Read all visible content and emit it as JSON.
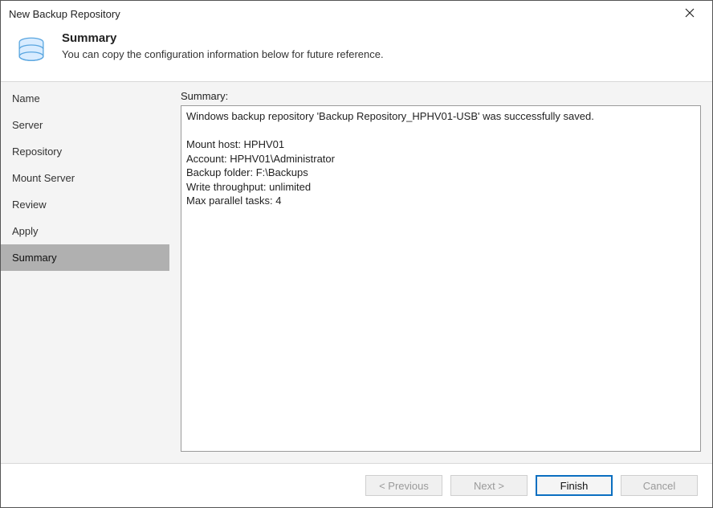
{
  "window": {
    "title": "New Backup Repository"
  },
  "header": {
    "heading": "Summary",
    "subheading": "You can copy the configuration information below for future reference."
  },
  "sidebar": {
    "items": [
      {
        "label": "Name",
        "active": false
      },
      {
        "label": "Server",
        "active": false
      },
      {
        "label": "Repository",
        "active": false
      },
      {
        "label": "Mount Server",
        "active": false
      },
      {
        "label": "Review",
        "active": false
      },
      {
        "label": "Apply",
        "active": false
      },
      {
        "label": "Summary",
        "active": true
      }
    ]
  },
  "content": {
    "label": "Summary:",
    "text": "Windows backup repository 'Backup Repository_HPHV01-USB' was successfully saved.\n\nMount host: HPHV01\nAccount: HPHV01\\Administrator\nBackup folder: F:\\Backups\nWrite throughput: unlimited\nMax parallel tasks: 4"
  },
  "footer": {
    "previous": "< Previous",
    "next": "Next >",
    "finish": "Finish",
    "cancel": "Cancel"
  }
}
